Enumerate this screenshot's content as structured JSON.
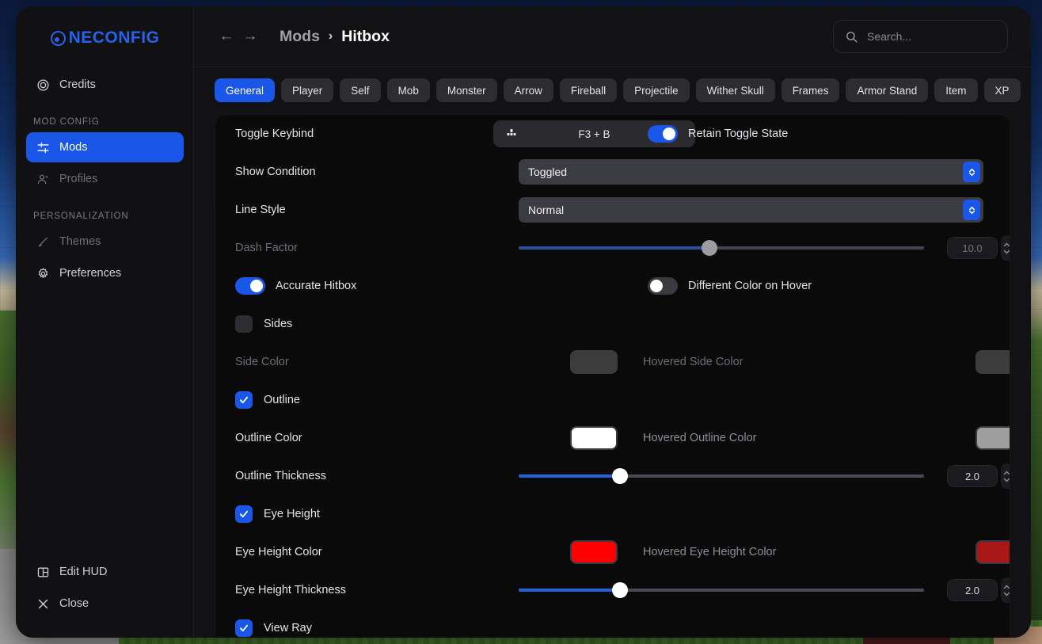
{
  "app": {
    "brand": "NECONFIG",
    "logo_icon": "oneconfig-logo-icon"
  },
  "sidebar": {
    "top_items": [
      {
        "label": "Credits",
        "icon": "credits-icon",
        "active": false,
        "dim": false
      }
    ],
    "groups": [
      {
        "label": "MOD CONFIG",
        "items": [
          {
            "label": "Mods",
            "icon": "sliders-icon",
            "active": true,
            "dim": false
          },
          {
            "label": "Profiles",
            "icon": "profiles-icon",
            "active": false,
            "dim": true
          }
        ]
      },
      {
        "label": "PERSONALIZATION",
        "items": [
          {
            "label": "Themes",
            "icon": "brush-icon",
            "active": false,
            "dim": true
          },
          {
            "label": "Preferences",
            "icon": "gear-icon",
            "active": false,
            "dim": false
          }
        ]
      }
    ],
    "bottom_items": [
      {
        "label": "Edit HUD",
        "icon": "layout-icon"
      },
      {
        "label": "Close",
        "icon": "close-icon"
      }
    ]
  },
  "topbar": {
    "back_icon": "arrow-left-icon",
    "forward_icon": "arrow-right-icon",
    "breadcrumb": {
      "parent": "Mods",
      "separator": "›",
      "current": "Hitbox"
    },
    "search": {
      "placeholder": "Search...",
      "value": "",
      "icon": "search-icon"
    }
  },
  "tabs": [
    {
      "label": "General",
      "active": true
    },
    {
      "label": "Player",
      "active": false
    },
    {
      "label": "Self",
      "active": false
    },
    {
      "label": "Mob",
      "active": false
    },
    {
      "label": "Monster",
      "active": false
    },
    {
      "label": "Arrow",
      "active": false
    },
    {
      "label": "Fireball",
      "active": false
    },
    {
      "label": "Projectile",
      "active": false
    },
    {
      "label": "Wither Skull",
      "active": false
    },
    {
      "label": "Frames",
      "active": false
    },
    {
      "label": "Armor Stand",
      "active": false
    },
    {
      "label": "Item",
      "active": false
    },
    {
      "label": "XP",
      "active": false
    }
  ],
  "settings": {
    "toggle_keybind": {
      "label": "Toggle Keybind",
      "keybind_icon": "keyboard-icon",
      "keybind_value": "F3 + B",
      "retain_label": "Retain Toggle State",
      "retain_on": true
    },
    "show_condition": {
      "label": "Show Condition",
      "value": "Toggled",
      "chevron_icon": "chevron-updown-icon"
    },
    "line_style": {
      "label": "Line Style",
      "value": "Normal",
      "chevron_icon": "chevron-updown-icon"
    },
    "dash_factor": {
      "label": "Dash Factor",
      "value": "10.0",
      "percent": 47,
      "disabled": true
    },
    "accurate_hitbox": {
      "label": "Accurate Hitbox",
      "on": true
    },
    "different_color_on_hover": {
      "label": "Different Color on Hover",
      "on": false
    },
    "sides": {
      "label": "Sides",
      "checked": false
    },
    "side_color": {
      "label": "Side Color",
      "color": "#3c3c3c",
      "hover_label": "Hovered Side Color",
      "hover_color": "#3c3c3c",
      "disabled": true
    },
    "outline": {
      "label": "Outline",
      "checked": true
    },
    "outline_color": {
      "label": "Outline Color",
      "color": "#ffffff",
      "hover_label": "Hovered Outline Color",
      "hover_color": "#9e9e9e"
    },
    "outline_thickness": {
      "label": "Outline Thickness",
      "value": "2.0",
      "percent": 25
    },
    "eye_height": {
      "label": "Eye Height",
      "checked": true
    },
    "eye_height_color": {
      "label": "Eye Height Color",
      "color": "#ff0000",
      "hover_label": "Hovered Eye Height Color",
      "hover_color": "#a81616"
    },
    "eye_height_thickness": {
      "label": "Eye Height Thickness",
      "value": "2.0",
      "percent": 25
    },
    "view_ray": {
      "label": "View Ray",
      "checked": true
    }
  },
  "theme": {
    "accent": "#1a56e8",
    "panel_bg": "#0a0a0b",
    "window_bg": "#0d0d0f",
    "sidebar_bg": "#111113"
  }
}
